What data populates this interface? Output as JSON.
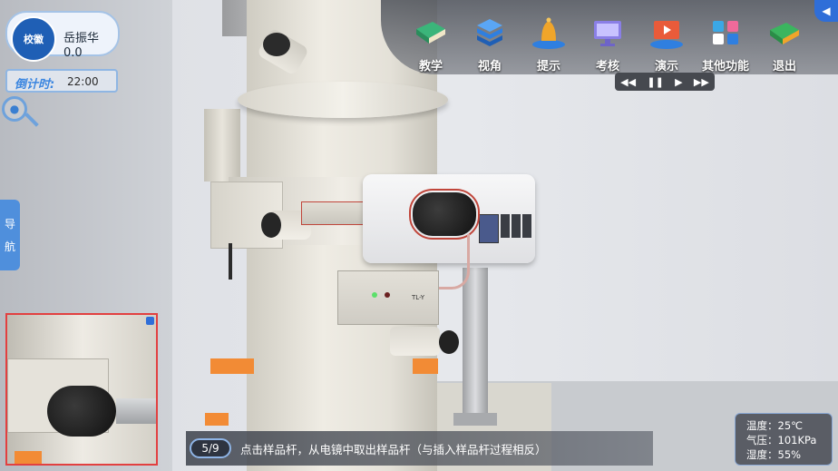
{
  "user": {
    "logo_text": "校徽",
    "name": "岳振华",
    "score": "0.0"
  },
  "countdown": {
    "label": "倒计时:",
    "value": "22:00"
  },
  "nav": {
    "label_1": "导",
    "label_2": "航"
  },
  "toolbar": {
    "items": [
      {
        "label": "教学",
        "icon": "book-icon",
        "color": "#3bb57a"
      },
      {
        "label": "视角",
        "icon": "cube-icon",
        "color": "#2f7fe0"
      },
      {
        "label": "提示",
        "icon": "bell-icon",
        "color": "#f0a52a"
      },
      {
        "label": "考核",
        "icon": "monitor-icon",
        "color": "#8a7fe6"
      },
      {
        "label": "演示",
        "icon": "presentation-icon",
        "color": "#e95b3a"
      },
      {
        "label": "其他功能",
        "icon": "apps-icon",
        "color": "#3aa8e6"
      },
      {
        "label": "退出",
        "icon": "exit-icon",
        "color": "#3bb55f"
      }
    ]
  },
  "media": {
    "rewind": "◀◀",
    "pause": "❚❚",
    "play": "▶",
    "forward": "▶▶"
  },
  "step": {
    "counter": "5/9",
    "instruction": "点击样品杆，从电镜中取出样品杆（与插入样品杆过程相反）"
  },
  "environment": {
    "temperature": "温度：25℃",
    "pressure": "气压：101KPa",
    "humidity": "湿度：55%"
  },
  "scene_labels": {
    "controller_text": "TL-Y"
  }
}
